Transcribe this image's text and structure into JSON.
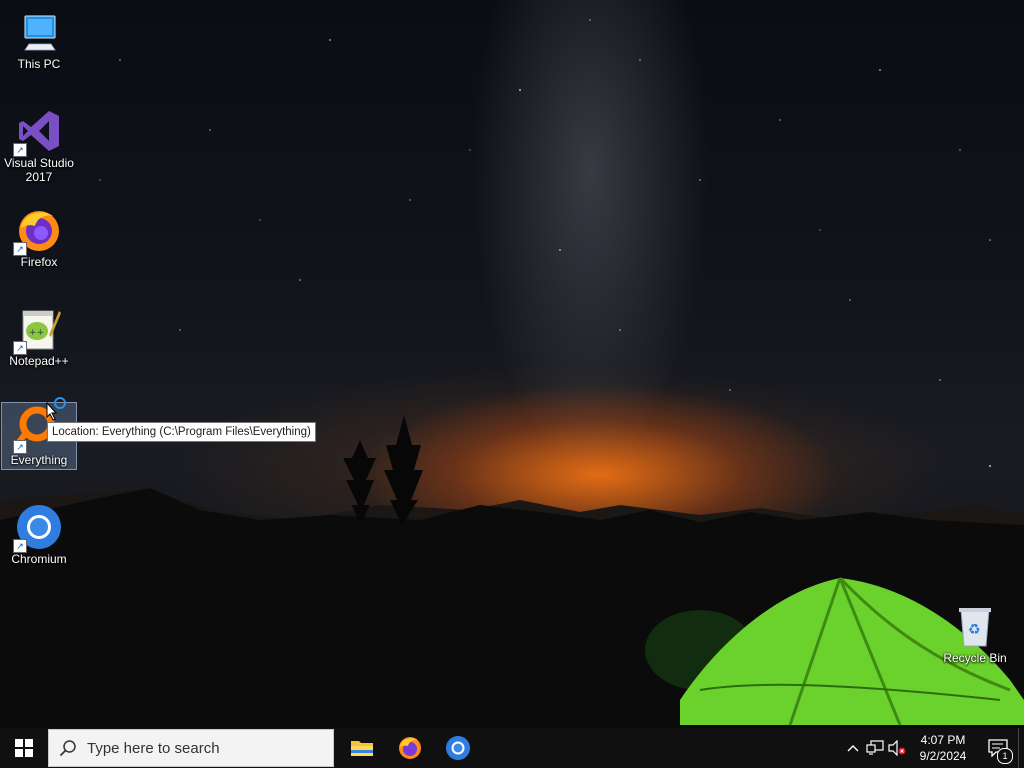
{
  "desktop": {
    "icons": [
      {
        "label": "This PC",
        "icon": "computer-icon"
      },
      {
        "label": "Visual Studio 2017",
        "icon": "visual-studio-icon"
      },
      {
        "label": "Firefox",
        "icon": "firefox-icon"
      },
      {
        "label": "Notepad++",
        "icon": "notepad-plus-plus-icon"
      },
      {
        "label": "Everything",
        "icon": "everything-search-icon"
      },
      {
        "label": "Chromium",
        "icon": "chromium-icon"
      }
    ],
    "recycle_bin": {
      "label": "Recycle Bin",
      "icon": "recycle-bin-icon"
    },
    "tooltip": "Location: Everything (C:\\Program Files\\Everything)"
  },
  "taskbar": {
    "search_placeholder": "Type here to search",
    "pinned_apps": [
      {
        "name": "File Explorer",
        "icon": "folder-icon"
      },
      {
        "name": "Firefox",
        "icon": "firefox-icon"
      },
      {
        "name": "Chromium",
        "icon": "chromium-icon"
      }
    ],
    "clock": {
      "time": "4:07 PM",
      "date": "9/2/2024"
    },
    "notification_count": "1"
  },
  "colors": {
    "taskbar": "#101010",
    "selection": "#7896be",
    "sunset": "#ff7a14",
    "tent": "#7ee03a"
  }
}
